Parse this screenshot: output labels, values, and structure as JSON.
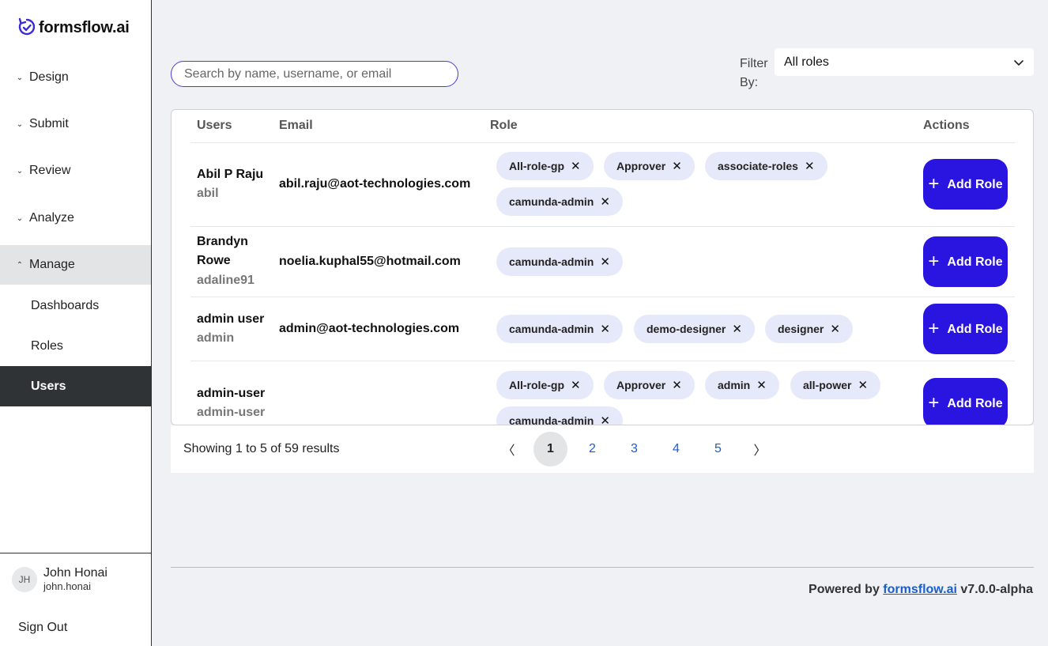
{
  "brand": {
    "name": "formsflow.ai"
  },
  "sidebar": {
    "nav": [
      {
        "label": "Design",
        "expanded": false
      },
      {
        "label": "Submit",
        "expanded": false
      },
      {
        "label": "Review",
        "expanded": false
      },
      {
        "label": "Analyze",
        "expanded": false
      },
      {
        "label": "Manage",
        "expanded": true
      }
    ],
    "sub_items": [
      {
        "label": "Dashboards",
        "active": false
      },
      {
        "label": "Roles",
        "active": false
      },
      {
        "label": "Users",
        "active": true
      }
    ],
    "user": {
      "initials": "JH",
      "name": "John Honai",
      "username": "john.honai"
    },
    "sign_out": "Sign Out"
  },
  "search": {
    "placeholder": "Search by name, username, or email",
    "value": ""
  },
  "filter": {
    "label": "Filter By:",
    "selected": "All roles"
  },
  "table": {
    "headers": {
      "users": "Users",
      "email": "Email",
      "role": "Role",
      "actions": "Actions"
    },
    "rows": [
      {
        "name": "Abil P Raju",
        "username": "abil",
        "email": "abil.raju@aot-technologies.com",
        "roles": [
          "All-role-gp",
          "Approver",
          "associate-roles",
          "camunda-admin"
        ]
      },
      {
        "name": "Brandyn Rowe",
        "username": "adaline91",
        "email": "noelia.kuphal55@hotmail.com",
        "roles": [
          "camunda-admin"
        ]
      },
      {
        "name": "admin user",
        "username": "admin",
        "email": "admin@aot-technologies.com",
        "roles": [
          "camunda-admin",
          "demo-designer",
          "designer"
        ]
      },
      {
        "name": "admin-user",
        "username": "admin-user",
        "email": "",
        "roles": [
          "All-role-gp",
          "Approver",
          "admin",
          "all-power",
          "camunda-admin"
        ]
      }
    ],
    "add_role_label": "Add Role",
    "remove_symbol": "✕"
  },
  "pagination": {
    "summary": "Showing 1 to 5 of 59 results",
    "prev": "〈",
    "next": "〉",
    "pages": [
      "1",
      "2",
      "3",
      "4",
      "5"
    ],
    "current": "1"
  },
  "footer": {
    "prefix": "Powered by",
    "link": "formsflow.ai",
    "version": "v7.0.0-alpha"
  },
  "colors": {
    "accent": "#2a14e0",
    "chip": "#e6e9f9",
    "active_nav": "#303336",
    "link": "#1a5fc9"
  }
}
